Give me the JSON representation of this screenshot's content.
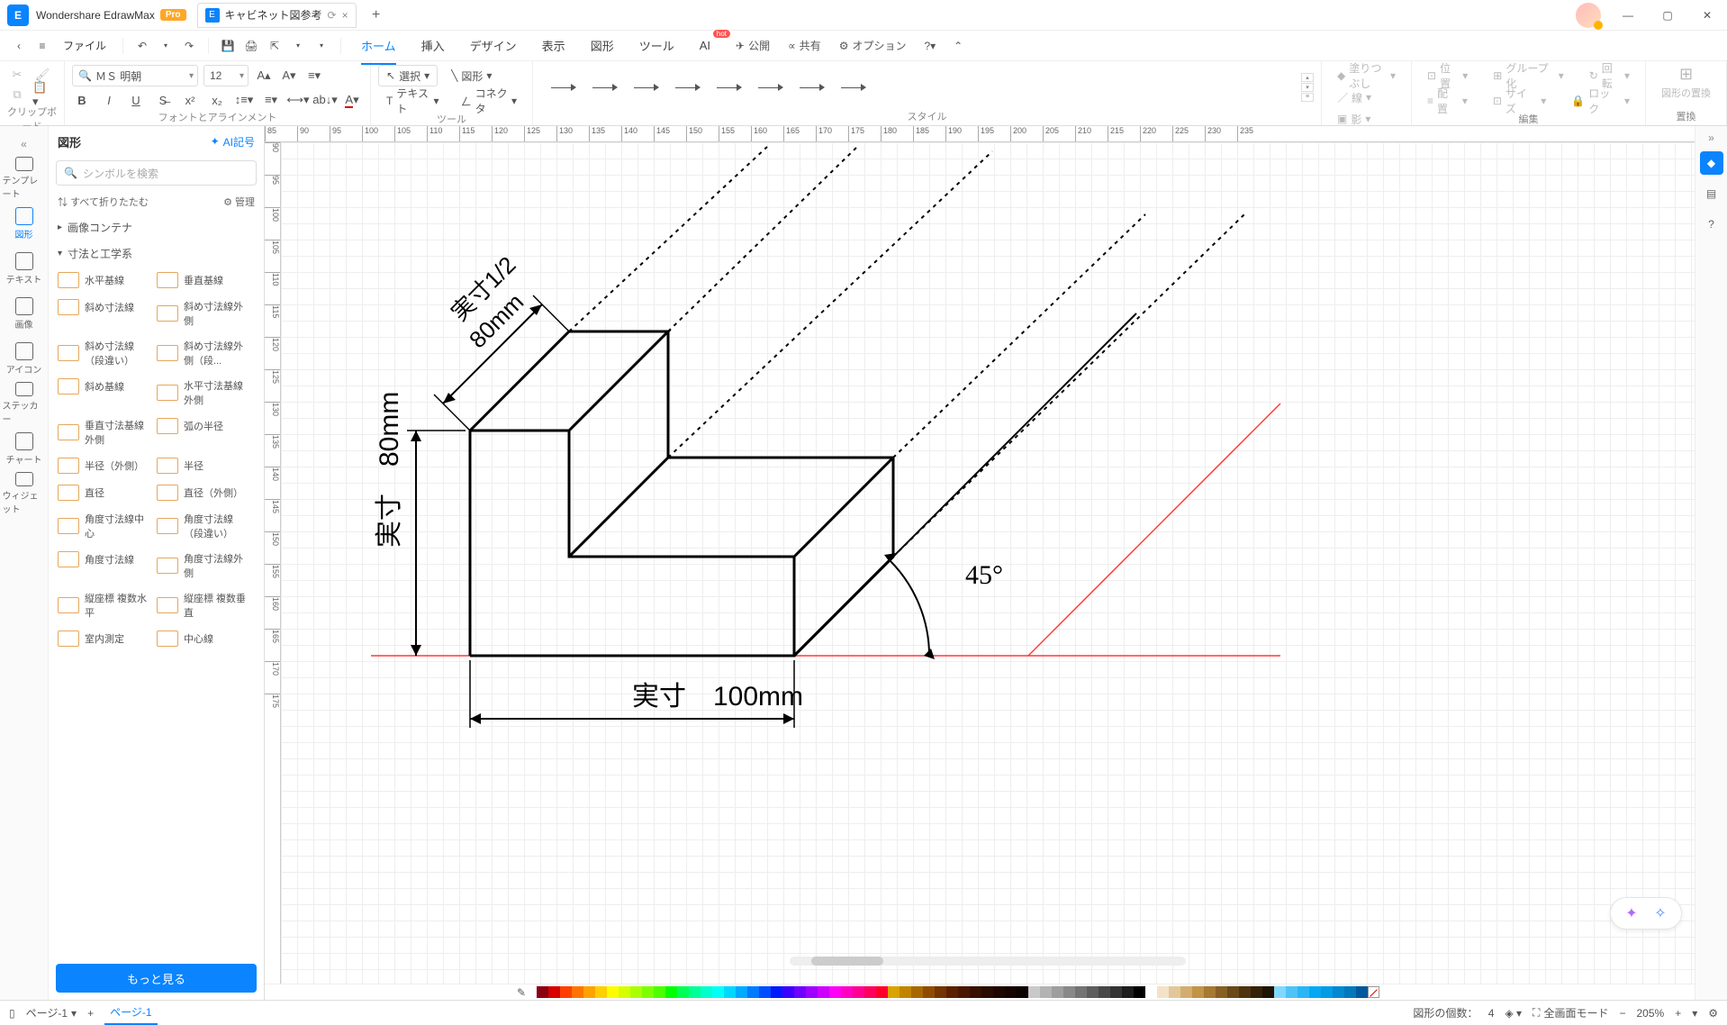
{
  "app": {
    "name": "Wondershare EdrawMax",
    "badge": "Pro"
  },
  "document": {
    "title": "キャビネット図参考",
    "close": "×",
    "add": "+"
  },
  "window": {
    "min": "—",
    "max": "▢",
    "close": "✕"
  },
  "menubar": {
    "back": "‹",
    "hamburger": "≡",
    "file": "ファイル",
    "items": [
      "ホーム",
      "挿入",
      "デザイン",
      "表示",
      "図形",
      "ツール",
      "AI"
    ],
    "hot": "hot",
    "publish": "公開",
    "share": "共有",
    "options": "オプション"
  },
  "ribbon": {
    "clipboard": {
      "label": "クリップボード"
    },
    "font": {
      "name": "ＭＳ 明朝",
      "size": "12",
      "label": "フォントとアラインメント"
    },
    "tools": {
      "select": "選択",
      "text": "テキスト",
      "shape": "図形",
      "connector": "コネクタ",
      "label": "ツール"
    },
    "style": {
      "label": "スタイル"
    },
    "fill": "塗りつぶし",
    "line": "線",
    "shadow": "影",
    "layout": {
      "position": "位置",
      "align": "配置",
      "group": "グループ化",
      "size": "サイズ",
      "rotate": "回転",
      "lock": "ロック",
      "label": "編集"
    },
    "replace": {
      "button": "図形の置換",
      "label": "置換"
    }
  },
  "leftrail": {
    "items": [
      {
        "label": "テンプレート"
      },
      {
        "label": "図形"
      },
      {
        "label": "テキスト"
      },
      {
        "label": "画像"
      },
      {
        "label": "アイコン"
      },
      {
        "label": "ステッカー"
      },
      {
        "label": "チャート"
      },
      {
        "label": "ウィジェット"
      }
    ]
  },
  "shapes": {
    "title": "図形",
    "ai": "AI記号",
    "search_placeholder": "シンボルを検索",
    "collapse": "すべて折りたたむ",
    "manage": "管理",
    "cat1": "画像コンテナ",
    "cat2": "寸法と工学系",
    "items": [
      "水平基線",
      "垂直基線",
      "斜め寸法線",
      "斜め寸法線外側",
      "斜め寸法線（段違い）",
      "斜め寸法線外側（段...",
      "斜め基線",
      "水平寸法基線外側",
      "垂直寸法基線外側",
      "弧の半径",
      "半径（外側）",
      "半径",
      "直径",
      "直径（外側）",
      "角度寸法線中心",
      "角度寸法線（段違い）",
      "角度寸法線",
      "角度寸法線外側",
      "縦座標 複数水平",
      "縦座標 複数垂直",
      "室内測定",
      "中心線"
    ],
    "more": "もっと見る"
  },
  "drawing": {
    "label_top": "実寸1/2",
    "value_top": "80mm",
    "label_left": "実寸",
    "value_left": "80mm",
    "label_bottom": "実寸",
    "value_bottom": "100mm",
    "angle": "45°"
  },
  "rulerH": [
    85,
    90,
    95,
    100,
    105,
    110,
    115,
    120,
    125,
    130,
    135,
    140,
    145,
    150,
    155,
    160,
    165,
    170,
    175,
    180,
    185,
    190,
    195,
    200,
    205,
    210,
    215,
    220,
    225,
    230,
    235
  ],
  "rulerV": [
    90,
    95,
    100,
    105,
    110,
    115,
    120,
    125,
    130,
    135,
    140,
    145,
    150,
    155,
    160,
    165,
    170,
    175
  ],
  "colors": [
    "#8b0012",
    "#d60000",
    "#ff3e00",
    "#ff7400",
    "#ffa200",
    "#ffcf00",
    "#fffb00",
    "#d5ff00",
    "#aaff00",
    "#7dff00",
    "#4cff00",
    "#00ff00",
    "#00ff55",
    "#00ff95",
    "#00ffcc",
    "#00fff6",
    "#00d7ff",
    "#00aaff",
    "#007bff",
    "#004cff",
    "#0019ff",
    "#3a00ff",
    "#6d00ff",
    "#9e00ff",
    "#cd00ff",
    "#ff00f6",
    "#ff00c3",
    "#ff0091",
    "#ff005e",
    "#ff002b",
    "#d9a300",
    "#c28400",
    "#a96700",
    "#8f4c00",
    "#753400",
    "#5c2000",
    "#4a1600",
    "#381000",
    "#2a0b00",
    "#1e0700",
    "#150400",
    "#0c0200",
    "#c9c9c9",
    "#b3b3b3",
    "#9e9e9e",
    "#888888",
    "#737373",
    "#5d5d5d",
    "#474747",
    "#323232",
    "#1c1c1c",
    "#000000",
    "#ffffff",
    "#f3e2c7",
    "#e3c79b",
    "#d3ad70",
    "#c39346",
    "#a67a32",
    "#876024",
    "#6a4919",
    "#4e3310",
    "#352108",
    "#1f1303",
    "#80d8ff",
    "#4fc3f7",
    "#29b6f6",
    "#03a9f4",
    "#039be5",
    "#0288d1",
    "#0277bd",
    "#01579b"
  ],
  "status": {
    "page_label": "ページ-1",
    "page_tab": "ページ-1",
    "shape_count_label": "図形の個数：",
    "shape_count": "4",
    "fullscreen": "全画面モード",
    "zoom": "205%"
  }
}
